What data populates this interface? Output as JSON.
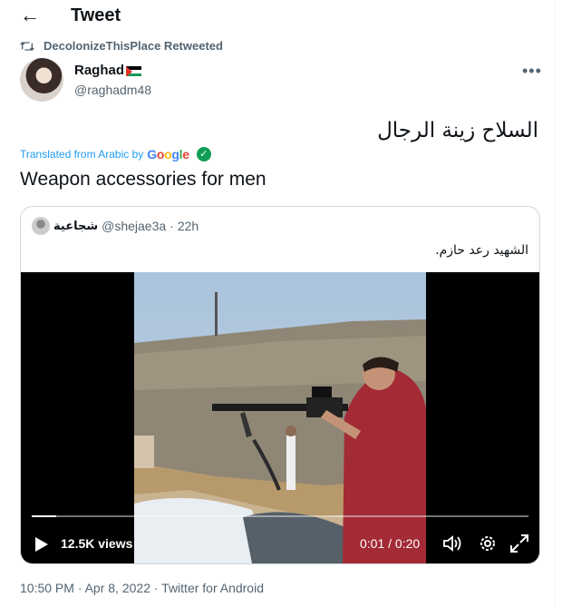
{
  "header": {
    "title": "Tweet",
    "back_icon": "arrow-left-icon"
  },
  "retweet": {
    "text": "DecolonizeThisPlace Retweeted",
    "icon": "retweet-icon"
  },
  "author": {
    "name": "Raghad",
    "handle": "@raghadm48",
    "flag": "palestine-flag"
  },
  "tweet": {
    "text_original": "السلاح زينة الرجال",
    "translated_prefix": "Translated from Arabic by",
    "translator": "Google",
    "translated_text": "Weapon accessories for men"
  },
  "quote": {
    "name": "شجاعية",
    "handle": "@shejae3a",
    "separator": "·",
    "time": "22h",
    "text": "الشهيد رعد حازم."
  },
  "video": {
    "views": "12.5K views",
    "time": "0:01 / 0:20",
    "progress": 0.05
  },
  "footer": {
    "timestamp": "10:50 PM · Apr 8, 2022 · Twitter for Android"
  },
  "colors": {
    "accent": "#1d9bf0",
    "secondary_text": "#536471",
    "border": "#cfd9de",
    "verified_green": "#0f9d58"
  }
}
